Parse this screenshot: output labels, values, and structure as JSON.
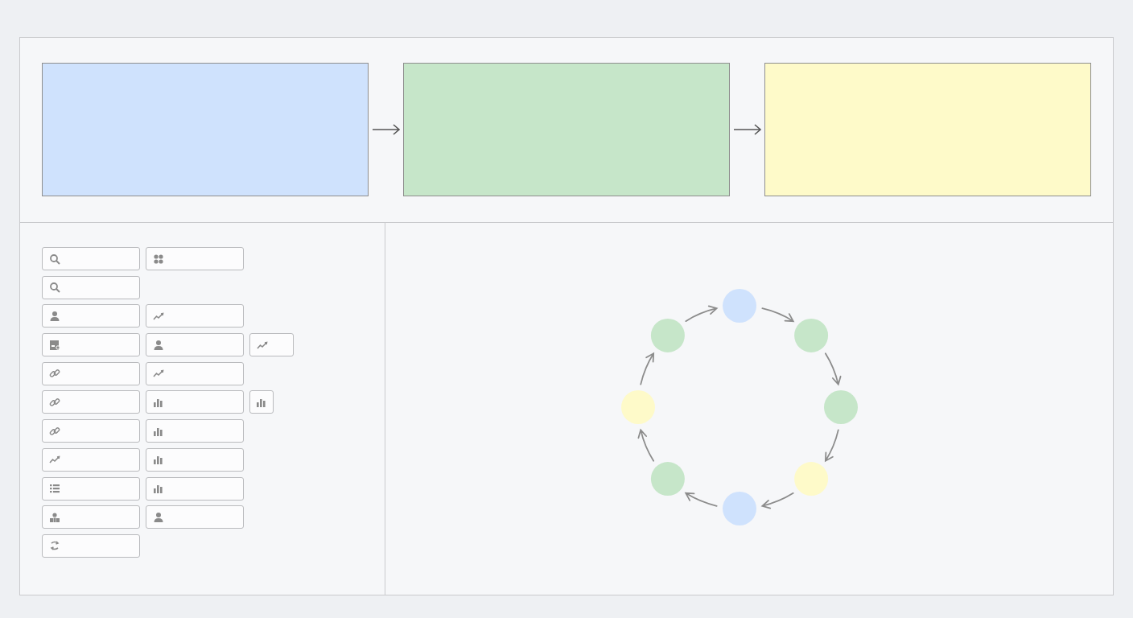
{
  "pipeline": {
    "stages": [
      {
        "color": "#cfe2fd"
      },
      {
        "color": "#c6e6c9"
      },
      {
        "color": "#fefac9"
      }
    ]
  },
  "palette": {
    "rows": [
      [
        {
          "kind": "search",
          "short": false,
          "compact": false
        },
        {
          "kind": "clover",
          "short": false,
          "compact": false
        }
      ],
      [
        {
          "kind": "search",
          "short": false,
          "compact": false
        }
      ],
      [
        {
          "kind": "person",
          "short": false,
          "compact": false
        },
        {
          "kind": "trend",
          "short": false,
          "compact": false
        }
      ],
      [
        {
          "kind": "chart-doc",
          "short": false,
          "compact": false
        },
        {
          "kind": "person",
          "short": false,
          "compact": false
        },
        {
          "kind": "trend",
          "short": true,
          "compact": false
        }
      ],
      [
        {
          "kind": "link",
          "short": false,
          "compact": false
        },
        {
          "kind": "trend",
          "short": false,
          "compact": false
        }
      ],
      [
        {
          "kind": "link",
          "short": false,
          "compact": false
        },
        {
          "kind": "bars",
          "short": false,
          "compact": false
        },
        {
          "kind": "bars",
          "short": false,
          "compact": true
        }
      ],
      [
        {
          "kind": "link",
          "short": false,
          "compact": false
        },
        {
          "kind": "bars",
          "short": false,
          "compact": false
        }
      ],
      [
        {
          "kind": "trend",
          "short": false,
          "compact": false
        },
        {
          "kind": "bars",
          "short": false,
          "compact": false
        }
      ],
      [
        {
          "kind": "list",
          "short": false,
          "compact": false
        },
        {
          "kind": "bars",
          "short": false,
          "compact": false
        }
      ],
      [
        {
          "kind": "people",
          "short": false,
          "compact": false
        },
        {
          "kind": "person",
          "short": false,
          "compact": false
        }
      ],
      [
        {
          "kind": "swap",
          "short": false,
          "compact": false
        }
      ]
    ]
  },
  "cycle": {
    "nodes": [
      {
        "color": "#cfe2fd"
      },
      {
        "color": "#c6e6c9"
      },
      {
        "color": "#c6e6c9"
      },
      {
        "color": "#fefac9"
      },
      {
        "color": "#cfe2fd"
      },
      {
        "color": "#c6e6c9"
      },
      {
        "color": "#fefac9"
      },
      {
        "color": "#c6e6c9"
      }
    ]
  }
}
